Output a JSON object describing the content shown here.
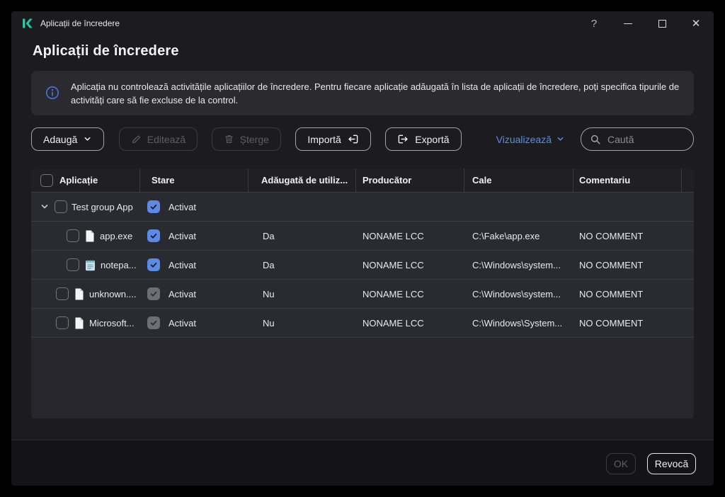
{
  "titlebar": {
    "title": "Aplicații de încredere",
    "help_label": "?"
  },
  "page": {
    "heading": "Aplicații de încredere",
    "banner_text": "Aplicația nu controlează activitățile aplicațiilor de încredere. Pentru fiecare aplicație adăugată în lista de aplicații de încredere, poți specifica tipurile de activități care să fie excluse de la control."
  },
  "toolbar": {
    "add_label": "Adaugă",
    "edit_label": "Editează",
    "delete_label": "Șterge",
    "import_label": "Importă",
    "export_label": "Exportă",
    "view_label": "Vizualizează",
    "search_placeholder": "Caută"
  },
  "table": {
    "columns": [
      "Aplicație",
      "Stare",
      "Adăugată de utiliz...",
      "Producător",
      "Cale",
      "Comentariu"
    ],
    "group": {
      "name": "Test group App",
      "status": "Activat",
      "status_checked": true,
      "expanded": true
    },
    "rows": [
      {
        "name": "app.exe",
        "icon": "file-icon",
        "status": "Activat",
        "status_checked": true,
        "status_disabled": false,
        "added": "Da",
        "vendor": "NONAME LCC",
        "path": "C:\\Fake\\app.exe",
        "comment": "NO COMMENT",
        "level": "child"
      },
      {
        "name": "notepa...",
        "icon": "notepad-icon",
        "status": "Activat",
        "status_checked": true,
        "status_disabled": false,
        "added": "Da",
        "vendor": "NONAME LCC",
        "path": "C:\\Windows\\system...",
        "comment": "NO COMMENT",
        "level": "child"
      },
      {
        "name": "unknown....",
        "icon": "file-icon",
        "status": "Activat",
        "status_checked": true,
        "status_disabled": true,
        "added": "Nu",
        "vendor": "NONAME LCC",
        "path": "C:\\Windows\\system...",
        "comment": "NO COMMENT",
        "level": "root"
      },
      {
        "name": "Microsoft...",
        "icon": "file-icon",
        "status": "Activat",
        "status_checked": true,
        "status_disabled": true,
        "added": "Nu",
        "vendor": "NONAME LCC",
        "path": "C:\\Windows\\System...",
        "comment": "NO COMMENT",
        "level": "root"
      }
    ]
  },
  "footer": {
    "ok_label": "OK",
    "cancel_label": "Revocă"
  },
  "colors": {
    "brand_teal": "#2bd4a9",
    "info_blue": "#4878e8",
    "link_blue": "#5b8de8",
    "checkbox_checked": "#5c8ae6",
    "window_bg": "#1c1c1f",
    "row_bg": "#2a2a31"
  }
}
